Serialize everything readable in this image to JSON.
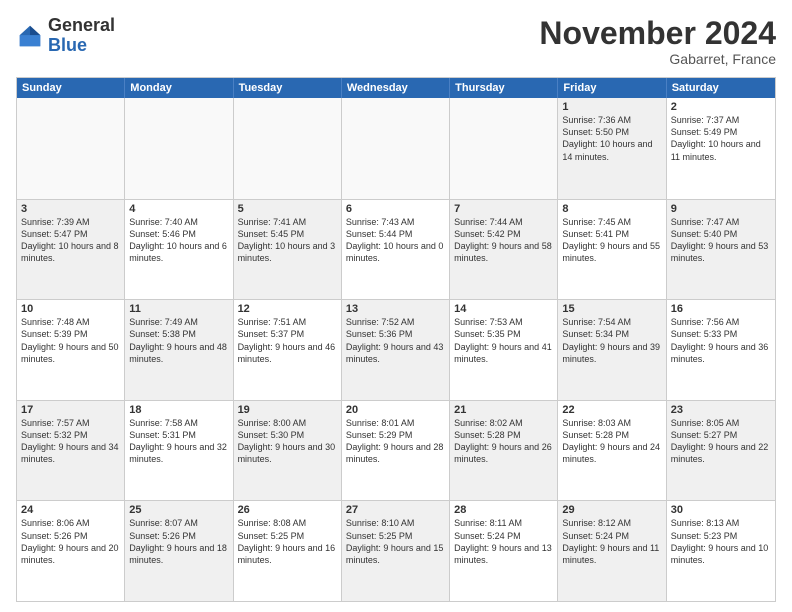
{
  "logo": {
    "line1": "General",
    "line2": "Blue"
  },
  "title": "November 2024",
  "subtitle": "Gabarret, France",
  "days_of_week": [
    "Sunday",
    "Monday",
    "Tuesday",
    "Wednesday",
    "Thursday",
    "Friday",
    "Saturday"
  ],
  "weeks": [
    [
      {
        "day": "",
        "info": "",
        "empty": true
      },
      {
        "day": "",
        "info": "",
        "empty": true
      },
      {
        "day": "",
        "info": "",
        "empty": true
      },
      {
        "day": "",
        "info": "",
        "empty": true
      },
      {
        "day": "",
        "info": "",
        "empty": true
      },
      {
        "day": "1",
        "info": "Sunrise: 7:36 AM\nSunset: 5:50 PM\nDaylight: 10 hours and 14 minutes.",
        "shaded": true
      },
      {
        "day": "2",
        "info": "Sunrise: 7:37 AM\nSunset: 5:49 PM\nDaylight: 10 hours and 11 minutes.",
        "shaded": false
      }
    ],
    [
      {
        "day": "3",
        "info": "Sunrise: 7:39 AM\nSunset: 5:47 PM\nDaylight: 10 hours and 8 minutes.",
        "shaded": true
      },
      {
        "day": "4",
        "info": "Sunrise: 7:40 AM\nSunset: 5:46 PM\nDaylight: 10 hours and 6 minutes.",
        "shaded": false
      },
      {
        "day": "5",
        "info": "Sunrise: 7:41 AM\nSunset: 5:45 PM\nDaylight: 10 hours and 3 minutes.",
        "shaded": true
      },
      {
        "day": "6",
        "info": "Sunrise: 7:43 AM\nSunset: 5:44 PM\nDaylight: 10 hours and 0 minutes.",
        "shaded": false
      },
      {
        "day": "7",
        "info": "Sunrise: 7:44 AM\nSunset: 5:42 PM\nDaylight: 9 hours and 58 minutes.",
        "shaded": true
      },
      {
        "day": "8",
        "info": "Sunrise: 7:45 AM\nSunset: 5:41 PM\nDaylight: 9 hours and 55 minutes.",
        "shaded": false
      },
      {
        "day": "9",
        "info": "Sunrise: 7:47 AM\nSunset: 5:40 PM\nDaylight: 9 hours and 53 minutes.",
        "shaded": true
      }
    ],
    [
      {
        "day": "10",
        "info": "Sunrise: 7:48 AM\nSunset: 5:39 PM\nDaylight: 9 hours and 50 minutes.",
        "shaded": false
      },
      {
        "day": "11",
        "info": "Sunrise: 7:49 AM\nSunset: 5:38 PM\nDaylight: 9 hours and 48 minutes.",
        "shaded": true
      },
      {
        "day": "12",
        "info": "Sunrise: 7:51 AM\nSunset: 5:37 PM\nDaylight: 9 hours and 46 minutes.",
        "shaded": false
      },
      {
        "day": "13",
        "info": "Sunrise: 7:52 AM\nSunset: 5:36 PM\nDaylight: 9 hours and 43 minutes.",
        "shaded": true
      },
      {
        "day": "14",
        "info": "Sunrise: 7:53 AM\nSunset: 5:35 PM\nDaylight: 9 hours and 41 minutes.",
        "shaded": false
      },
      {
        "day": "15",
        "info": "Sunrise: 7:54 AM\nSunset: 5:34 PM\nDaylight: 9 hours and 39 minutes.",
        "shaded": true
      },
      {
        "day": "16",
        "info": "Sunrise: 7:56 AM\nSunset: 5:33 PM\nDaylight: 9 hours and 36 minutes.",
        "shaded": false
      }
    ],
    [
      {
        "day": "17",
        "info": "Sunrise: 7:57 AM\nSunset: 5:32 PM\nDaylight: 9 hours and 34 minutes.",
        "shaded": true
      },
      {
        "day": "18",
        "info": "Sunrise: 7:58 AM\nSunset: 5:31 PM\nDaylight: 9 hours and 32 minutes.",
        "shaded": false
      },
      {
        "day": "19",
        "info": "Sunrise: 8:00 AM\nSunset: 5:30 PM\nDaylight: 9 hours and 30 minutes.",
        "shaded": true
      },
      {
        "day": "20",
        "info": "Sunrise: 8:01 AM\nSunset: 5:29 PM\nDaylight: 9 hours and 28 minutes.",
        "shaded": false
      },
      {
        "day": "21",
        "info": "Sunrise: 8:02 AM\nSunset: 5:28 PM\nDaylight: 9 hours and 26 minutes.",
        "shaded": true
      },
      {
        "day": "22",
        "info": "Sunrise: 8:03 AM\nSunset: 5:28 PM\nDaylight: 9 hours and 24 minutes.",
        "shaded": false
      },
      {
        "day": "23",
        "info": "Sunrise: 8:05 AM\nSunset: 5:27 PM\nDaylight: 9 hours and 22 minutes.",
        "shaded": true
      }
    ],
    [
      {
        "day": "24",
        "info": "Sunrise: 8:06 AM\nSunset: 5:26 PM\nDaylight: 9 hours and 20 minutes.",
        "shaded": false
      },
      {
        "day": "25",
        "info": "Sunrise: 8:07 AM\nSunset: 5:26 PM\nDaylight: 9 hours and 18 minutes.",
        "shaded": true
      },
      {
        "day": "26",
        "info": "Sunrise: 8:08 AM\nSunset: 5:25 PM\nDaylight: 9 hours and 16 minutes.",
        "shaded": false
      },
      {
        "day": "27",
        "info": "Sunrise: 8:10 AM\nSunset: 5:25 PM\nDaylight: 9 hours and 15 minutes.",
        "shaded": true
      },
      {
        "day": "28",
        "info": "Sunrise: 8:11 AM\nSunset: 5:24 PM\nDaylight: 9 hours and 13 minutes.",
        "shaded": false
      },
      {
        "day": "29",
        "info": "Sunrise: 8:12 AM\nSunset: 5:24 PM\nDaylight: 9 hours and 11 minutes.",
        "shaded": true
      },
      {
        "day": "30",
        "info": "Sunrise: 8:13 AM\nSunset: 5:23 PM\nDaylight: 9 hours and 10 minutes.",
        "shaded": false
      }
    ]
  ]
}
